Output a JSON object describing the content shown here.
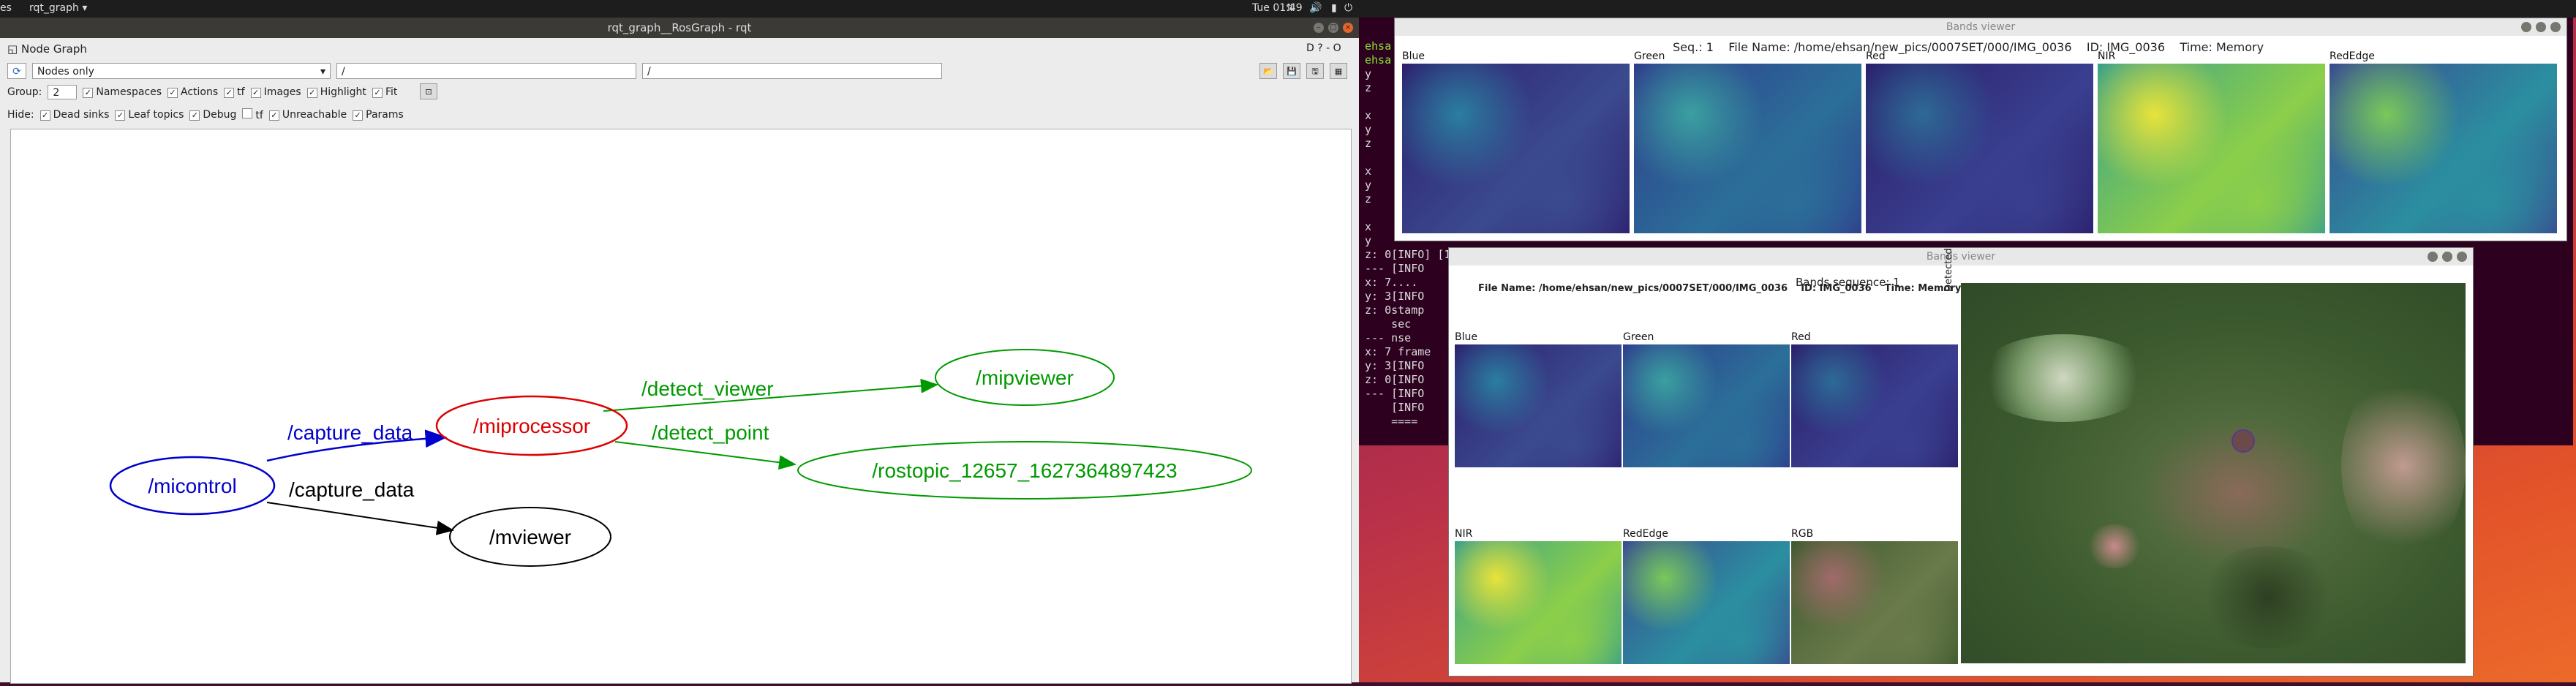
{
  "topbar": {
    "left_fragment": "es",
    "app_menu": "rqt_graph ▾",
    "clock": "Tue 01:49",
    "tray_icons": [
      "network-icon",
      "volume-icon",
      "battery-icon",
      "power-icon"
    ]
  },
  "rqt": {
    "title": "rqt_graph__RosGraph - rqt",
    "panel_title": "Node Graph",
    "help_buttons": "D ? - O",
    "filter_select": "Nodes only",
    "filter_input_1": "/",
    "filter_input_2": "/",
    "group_label": "Group:",
    "group_value": "2",
    "options_row1": [
      {
        "label": "Namespaces",
        "checked": true
      },
      {
        "label": "Actions",
        "checked": true
      },
      {
        "label": "tf",
        "checked": true
      },
      {
        "label": "Images",
        "checked": true
      },
      {
        "label": "Highlight",
        "checked": true
      },
      {
        "label": "Fit",
        "checked": true
      }
    ],
    "hide_label": "Hide:",
    "options_row2": [
      {
        "label": "Dead sinks",
        "checked": true
      },
      {
        "label": "Leaf topics",
        "checked": true
      },
      {
        "label": "Debug",
        "checked": true
      },
      {
        "label": "tf",
        "checked": false
      },
      {
        "label": "Unreachable",
        "checked": true
      },
      {
        "label": "Params",
        "checked": true
      }
    ],
    "graph": {
      "nodes": {
        "micontrol": "/micontrol",
        "miprocessor": "/miprocessor",
        "mviewer": "/mviewer",
        "mipviewer": "/mipviewer",
        "rostopic": "/rostopic_12657_1627364897423"
      },
      "edges": {
        "capture_1": "/capture_data",
        "capture_2": "/capture_data",
        "detect_viewer": "/detect_viewer",
        "detect_point": "/detect_point"
      },
      "colors": {
        "blue": "#0000cc",
        "red": "#dd0000",
        "green": "#009900",
        "black": "#000000"
      }
    }
  },
  "terminal": {
    "lines": [
      "ehsa",
      "ehsa",
      "y",
      "z",
      "",
      "x",
      "y",
      "z",
      "",
      "x",
      "y",
      "z",
      "",
      "x",
      "y",
      "z: 0[INFO] [1627364898.083535]: /home/ehsan/new_pics/0007SET/000/IMG_0036",
      "--- [INFO",
      "x: 7....",
      "y: 3[INFO",
      "z: 0stamp",
      "    sec",
      "--- nse",
      "x: 7 frame",
      "y: 3[INFO",
      "z: 0[INFO",
      "--- [INFO",
      "    [INFO",
      "    ===="
    ]
  },
  "bands_viewer_1": {
    "title": "Bands viewer",
    "seq_label": "Seq.: 1",
    "file_label": "File Name: /home/ehsan/new_pics/0007SET/000/IMG_0036",
    "id_label": "ID: IMG_0036",
    "time_label": "Time: Memory",
    "bands": [
      "Blue",
      "Green",
      "Red",
      "NIR",
      "RedEdge"
    ]
  },
  "bands_viewer_2": {
    "title": "Bands viewer",
    "file_label": "File Name: /home/ehsan/new_pics/0007SET/000/IMG_0036",
    "id_label": "ID: IMG_0036",
    "time_label": "Time: Memory",
    "sequence_label": "Bands sequence: 1",
    "detected_label": "Detected",
    "bands_top": [
      "Blue",
      "Green",
      "Red"
    ],
    "bands_bottom": [
      "NIR",
      "RedEdge",
      "RGB"
    ]
  }
}
